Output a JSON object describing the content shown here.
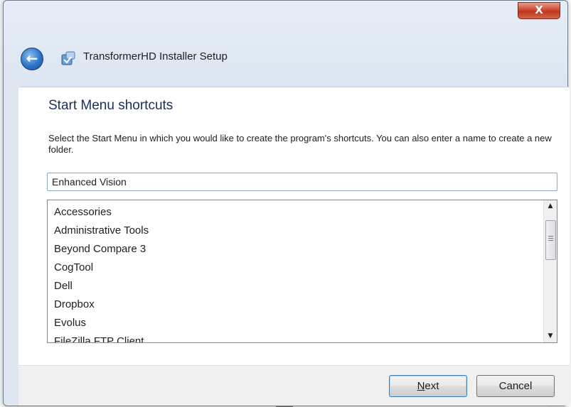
{
  "window": {
    "title": "TransformerHD Installer Setup",
    "close_label": "X"
  },
  "page": {
    "heading": "Start Menu shortcuts",
    "instructions": "Select the Start Menu in which you would like to create the program's shortcuts. You can also enter a name to create a new folder."
  },
  "folder_input": {
    "value": "Enhanced Vision"
  },
  "folder_list": {
    "items": [
      "Accessories",
      "Administrative Tools",
      "Beyond Compare 3",
      "CogTool",
      "Dell",
      "Dropbox",
      "Evolus",
      "FileZilla FTP Client"
    ]
  },
  "buttons": {
    "next_first": "N",
    "next_rest": "ext",
    "cancel": "Cancel"
  },
  "icons": {
    "back": "back-arrow-icon",
    "app": "installer-app-icon",
    "close": "close-icon",
    "scroll_up": "scroll-up-arrow-icon",
    "scroll_down": "scroll-down-arrow-icon"
  }
}
